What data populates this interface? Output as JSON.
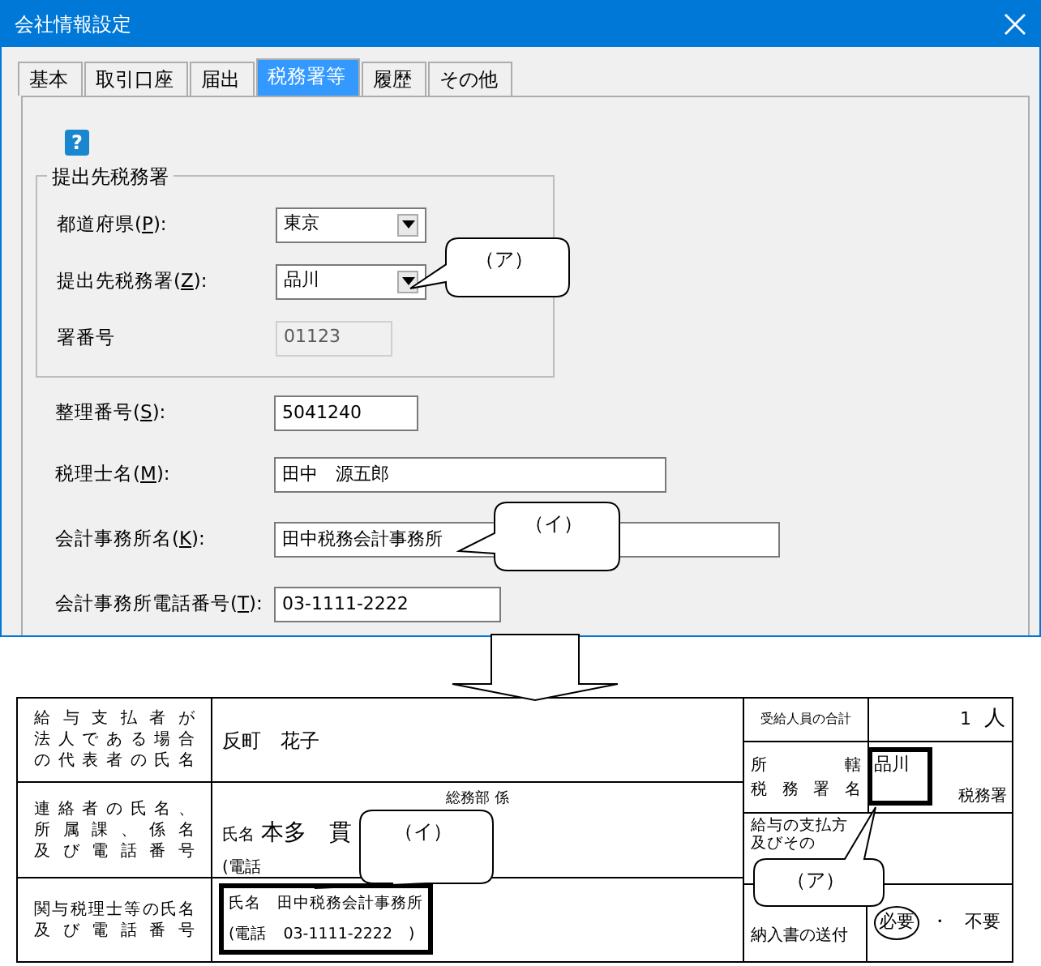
{
  "window": {
    "title": "会社情報設定"
  },
  "tabs": [
    {
      "label": "基本",
      "selected": false
    },
    {
      "label": "取引口座",
      "selected": false
    },
    {
      "label": "届出",
      "selected": false
    },
    {
      "label": "税務署等",
      "selected": true
    },
    {
      "label": "履歴",
      "selected": false
    },
    {
      "label": "その他",
      "selected": false
    }
  ],
  "help_glyph": "?",
  "group": {
    "legend": "提出先税務署",
    "fields": [
      {
        "kind": "select",
        "label_before": "都道府県(",
        "access_key": "P",
        "label_after": "):",
        "value": "東京",
        "disabled": false
      },
      {
        "kind": "select",
        "label_before": "提出先税務署(",
        "access_key": "Z",
        "label_after": "):",
        "value": "品川",
        "disabled": false
      },
      {
        "kind": "text",
        "label_before": "署番号",
        "value": "01123",
        "disabled": true
      }
    ]
  },
  "fields": [
    {
      "kind": "text",
      "label_before": "整理番号(",
      "access_key": "S",
      "label_after": "):",
      "value": "5041240",
      "disabled": false
    },
    {
      "kind": "text",
      "label_before": "税理士名(",
      "access_key": "M",
      "label_after": "):",
      "value": "田中　源五郎",
      "disabled": false
    },
    {
      "kind": "text",
      "label_before": "会計事務所名(",
      "access_key": "K",
      "label_after": "):",
      "value": "田中税務会計事務所",
      "disabled": false
    },
    {
      "kind": "text",
      "label_before": "会計事務所電話番号(",
      "access_key": "T",
      "label_after": "):",
      "value": "03-1111-2222",
      "disabled": false
    }
  ],
  "form": {
    "left_rows": [
      {
        "label_lines": [
          "給与支払者が",
          "法人である場合",
          "の代表者の氏名"
        ],
        "name": "反町　花子"
      },
      {
        "label_lines": [
          "連絡者の氏名、",
          "所属課、係名",
          "及び電話番号"
        ],
        "dept": "総務部 係",
        "name_caption": "氏名",
        "name": "本多　貫",
        "phone": "(電話"
      },
      {
        "label_lines": [
          "関与税理士等の氏名",
          "及び電話番号"
        ],
        "name_line": "氏名　田中税務会計事務所",
        "phone": "(電話　03-1111-2222　)"
      }
    ],
    "right_rows": [
      {
        "kind": "count",
        "label": "受給人員の合計",
        "value": "1",
        "unit": "人"
      },
      {
        "kind": "office",
        "label_lines": [
          "所轄",
          "税務署名"
        ],
        "value": "品川",
        "suffix": "税務署"
      },
      {
        "kind": "note",
        "label_lines": [
          "給与の支払方",
          "及びその"
        ]
      },
      {
        "kind": "choice",
        "label": "納入書の送付",
        "options": [
          {
            "label": "必要",
            "selected": true
          },
          {
            "label": "不要",
            "selected": false
          }
        ],
        "separator": "・"
      }
    ]
  },
  "callouts": [
    {
      "label": "（ア）"
    },
    {
      "label": "（イ）"
    },
    {
      "label": "（イ）"
    },
    {
      "label": "（ア）"
    }
  ]
}
